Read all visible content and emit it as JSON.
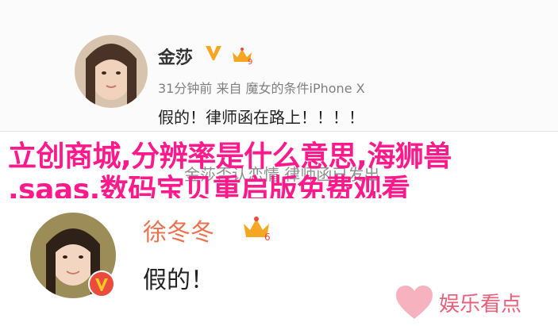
{
  "post1": {
    "username": "金莎",
    "meta": "31分钟前 来自 魔女的条件iPhone X",
    "text": "假的！律师函在路上！！！！",
    "badge_level": "9"
  },
  "overlay": {
    "line1": "立创商城,分辨率是什么意思,海狮兽",
    "line2": ",saas,数码宝贝重启版免费观看",
    "faint_text": "金莎否认恋情 律师函已发出"
  },
  "post2": {
    "username": "徐冬冬",
    "text": "假的！",
    "badge_level": "6"
  },
  "watermark": {
    "text": "娱乐看点"
  },
  "colors": {
    "overlay": "#ff1a8c",
    "username_orange": "#eb7350",
    "vip_yellow": "#f5a623",
    "watermark": "#e8607a"
  }
}
